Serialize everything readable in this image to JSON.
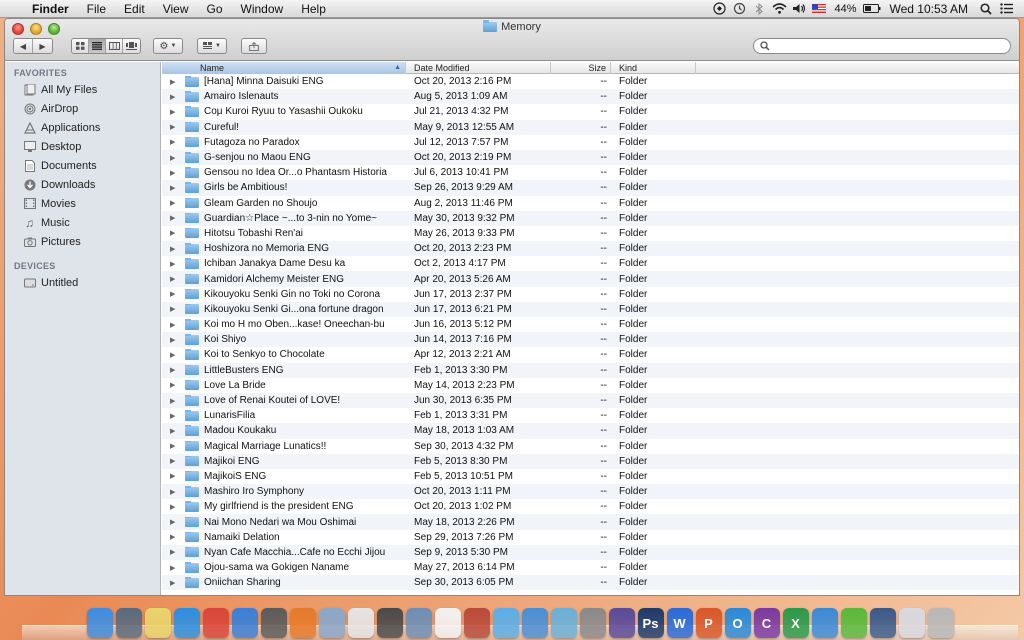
{
  "menubar": {
    "apple_glyph": "",
    "app_name": "Finder",
    "menus": [
      "File",
      "Edit",
      "View",
      "Go",
      "Window",
      "Help"
    ],
    "battery": "44%",
    "clock": "Wed 10:53 AM"
  },
  "window": {
    "title": "Memory",
    "search_placeholder": ""
  },
  "sidebar": {
    "favorites_header": "FAVORITES",
    "favorites": [
      "All My Files",
      "AirDrop",
      "Applications",
      "Desktop",
      "Documents",
      "Downloads",
      "Movies",
      "Music",
      "Pictures"
    ],
    "devices_header": "DEVICES",
    "devices": [
      "Untitled"
    ]
  },
  "columns": {
    "name": "Name",
    "date": "Date Modified",
    "size": "Size",
    "kind": "Kind"
  },
  "files": [
    {
      "name": "[Hana] Minna Daisuki ENG",
      "date": "Oct 20, 2013 2:16 PM",
      "size": "--",
      "kind": "Folder"
    },
    {
      "name": "Amairo Islenauts",
      "date": "Aug 5, 2013 1:09 AM",
      "size": "--",
      "kind": "Folder"
    },
    {
      "name": "Coμ Kuroi Ryuu to Yasashii Oukoku",
      "date": "Jul 21, 2013 4:32 PM",
      "size": "--",
      "kind": "Folder"
    },
    {
      "name": "Cureful!",
      "date": "May 9, 2013 12:55 AM",
      "size": "--",
      "kind": "Folder"
    },
    {
      "name": "Futagoza no Paradox",
      "date": "Jul 12, 2013 7:57 PM",
      "size": "--",
      "kind": "Folder"
    },
    {
      "name": "G-senjou no Maou ENG",
      "date": "Oct 20, 2013 2:19 PM",
      "size": "--",
      "kind": "Folder"
    },
    {
      "name": "Gensou no Idea Or...o Phantasm Historia",
      "date": "Jul 6, 2013 10:41 PM",
      "size": "--",
      "kind": "Folder"
    },
    {
      "name": "Girls be Ambitious!",
      "date": "Sep 26, 2013 9:29 AM",
      "size": "--",
      "kind": "Folder"
    },
    {
      "name": "Gleam Garden no Shoujo",
      "date": "Aug 2, 2013 11:46 PM",
      "size": "--",
      "kind": "Folder"
    },
    {
      "name": "Guardian☆Place ~...to 3-nin no Yome~",
      "date": "May 30, 2013 9:32 PM",
      "size": "--",
      "kind": "Folder"
    },
    {
      "name": "Hitotsu Tobashi Ren'ai",
      "date": "May 26, 2013 9:33 PM",
      "size": "--",
      "kind": "Folder"
    },
    {
      "name": "Hoshizora no Memoria ENG",
      "date": "Oct 20, 2013 2:23 PM",
      "size": "--",
      "kind": "Folder"
    },
    {
      "name": "Ichiban Janakya Dame Desu ka",
      "date": "Oct 2, 2013 4:17 PM",
      "size": "--",
      "kind": "Folder"
    },
    {
      "name": "Kamidori Alchemy Meister ENG",
      "date": "Apr 20, 2013 5:26 AM",
      "size": "--",
      "kind": "Folder"
    },
    {
      "name": "Kikouyoku Senki Gin no Toki no Corona",
      "date": "Jun 17, 2013 2:37 PM",
      "size": "--",
      "kind": "Folder"
    },
    {
      "name": "Kikouyoku Senki Gi...ona fortune dragon",
      "date": "Jun 17, 2013 6:21 PM",
      "size": "--",
      "kind": "Folder"
    },
    {
      "name": "Koi mo H mo Oben...kase! Oneechan-bu",
      "date": "Jun 16, 2013 5:12 PM",
      "size": "--",
      "kind": "Folder"
    },
    {
      "name": "Koi Shiyo",
      "date": "Jun 14, 2013 7:16 PM",
      "size": "--",
      "kind": "Folder"
    },
    {
      "name": "Koi to Senkyo to Chocolate",
      "date": "Apr 12, 2013 2:21 AM",
      "size": "--",
      "kind": "Folder"
    },
    {
      "name": "LittleBusters ENG",
      "date": "Feb 1, 2013 3:30 PM",
      "size": "--",
      "kind": "Folder"
    },
    {
      "name": "Love La Bride",
      "date": "May 14, 2013 2:23 PM",
      "size": "--",
      "kind": "Folder"
    },
    {
      "name": "Love of Renai Koutei of LOVE!",
      "date": "Jun 30, 2013 6:35 PM",
      "size": "--",
      "kind": "Folder"
    },
    {
      "name": "LunarisFilia",
      "date": "Feb 1, 2013 3:31 PM",
      "size": "--",
      "kind": "Folder"
    },
    {
      "name": "Madou Koukaku",
      "date": "May 18, 2013 1:03 AM",
      "size": "--",
      "kind": "Folder"
    },
    {
      "name": "Magical Marriage Lunatics!!",
      "date": "Sep 30, 2013 4:32 PM",
      "size": "--",
      "kind": "Folder"
    },
    {
      "name": "Majikoi ENG",
      "date": "Feb 5, 2013 8:30 PM",
      "size": "--",
      "kind": "Folder"
    },
    {
      "name": "MajikoiS ENG",
      "date": "Feb 5, 2013 10:51 PM",
      "size": "--",
      "kind": "Folder"
    },
    {
      "name": "Mashiro Iro Symphony",
      "date": "Oct 20, 2013 1:11 PM",
      "size": "--",
      "kind": "Folder"
    },
    {
      "name": "My girlfriend is the president ENG",
      "date": "Oct 20, 2013 1:02 PM",
      "size": "--",
      "kind": "Folder"
    },
    {
      "name": "Nai Mono Nedari wa Mou Oshimai",
      "date": "May 18, 2013 2:26 PM",
      "size": "--",
      "kind": "Folder"
    },
    {
      "name": "Namaiki Delation",
      "date": "Sep 29, 2013 7:26 PM",
      "size": "--",
      "kind": "Folder"
    },
    {
      "name": "Nyan Cafe Macchia...Cafe no Ecchi Jijou",
      "date": "Sep 9, 2013 5:30 PM",
      "size": "--",
      "kind": "Folder"
    },
    {
      "name": "Ojou-sama wa Gokigen Naname",
      "date": "May 27, 2013 6:14 PM",
      "size": "--",
      "kind": "Folder"
    },
    {
      "name": "Oniichan Sharing",
      "date": "Sep 30, 2013 6:05 PM",
      "size": "--",
      "kind": "Folder"
    }
  ],
  "dock": {
    "apps": [
      {
        "name": "finder-icon",
        "color": "#3f8de0",
        "glyph": ""
      },
      {
        "name": "mission-control-icon",
        "color": "#5a6b7d",
        "glyph": ""
      },
      {
        "name": "notes-icon",
        "color": "#e9d46a",
        "glyph": ""
      },
      {
        "name": "safari-icon",
        "color": "#2d8fe0",
        "glyph": ""
      },
      {
        "name": "chrome-icon",
        "color": "#d9463a",
        "glyph": ""
      },
      {
        "name": "app-store-icon",
        "color": "#3a7fd8",
        "glyph": ""
      },
      {
        "name": "photo-booth-icon",
        "color": "#5b5b5b",
        "glyph": ""
      },
      {
        "name": "firefox-icon",
        "color": "#e67a2a",
        "glyph": ""
      },
      {
        "name": "preview-icon",
        "color": "#8aa7c9",
        "glyph": ""
      },
      {
        "name": "textedit-icon",
        "color": "#e5e5e5",
        "glyph": ""
      },
      {
        "name": "facetime-icon",
        "color": "#4a4a4a",
        "glyph": ""
      },
      {
        "name": "iphoto-icon",
        "color": "#6d8fb5",
        "glyph": ""
      },
      {
        "name": "calendar-icon",
        "color": "#f2f2f2",
        "glyph": ""
      },
      {
        "name": "photo-icon",
        "color": "#b94a3a",
        "glyph": ""
      },
      {
        "name": "messages-icon",
        "color": "#5aaee8",
        "glyph": ""
      },
      {
        "name": "itunes-icon",
        "color": "#4a8fd8",
        "glyph": ""
      },
      {
        "name": "game-center-icon",
        "color": "#6ab0d8",
        "glyph": ""
      },
      {
        "name": "system-preferences-icon",
        "color": "#8a8a8a",
        "glyph": ""
      },
      {
        "name": "dashboard-icon",
        "color": "#5a4a9a",
        "glyph": ""
      },
      {
        "name": "photoshop-icon",
        "color": "#1d3a6a",
        "glyph": "Ps"
      },
      {
        "name": "word-icon",
        "color": "#2a6ad8",
        "glyph": "W"
      },
      {
        "name": "powerpoint-icon",
        "color": "#d8582a",
        "glyph": "P"
      },
      {
        "name": "outlook-icon",
        "color": "#2a8ad8",
        "glyph": "O"
      },
      {
        "name": "onenote-icon",
        "color": "#7a3aa0",
        "glyph": "C"
      },
      {
        "name": "excel-icon",
        "color": "#2a9a4a",
        "glyph": "X"
      },
      {
        "name": "lync-icon",
        "color": "#3a8ad8",
        "glyph": ""
      },
      {
        "name": "messenger-icon",
        "color": "#5ab83a",
        "glyph": ""
      },
      {
        "name": "remote-desktop-icon",
        "color": "#3a5a8a",
        "glyph": ""
      },
      {
        "name": "documents-folder-icon",
        "color": "#d8d8e0",
        "glyph": ""
      },
      {
        "name": "trash-icon",
        "color": "#b8b8b8",
        "glyph": ""
      }
    ]
  }
}
